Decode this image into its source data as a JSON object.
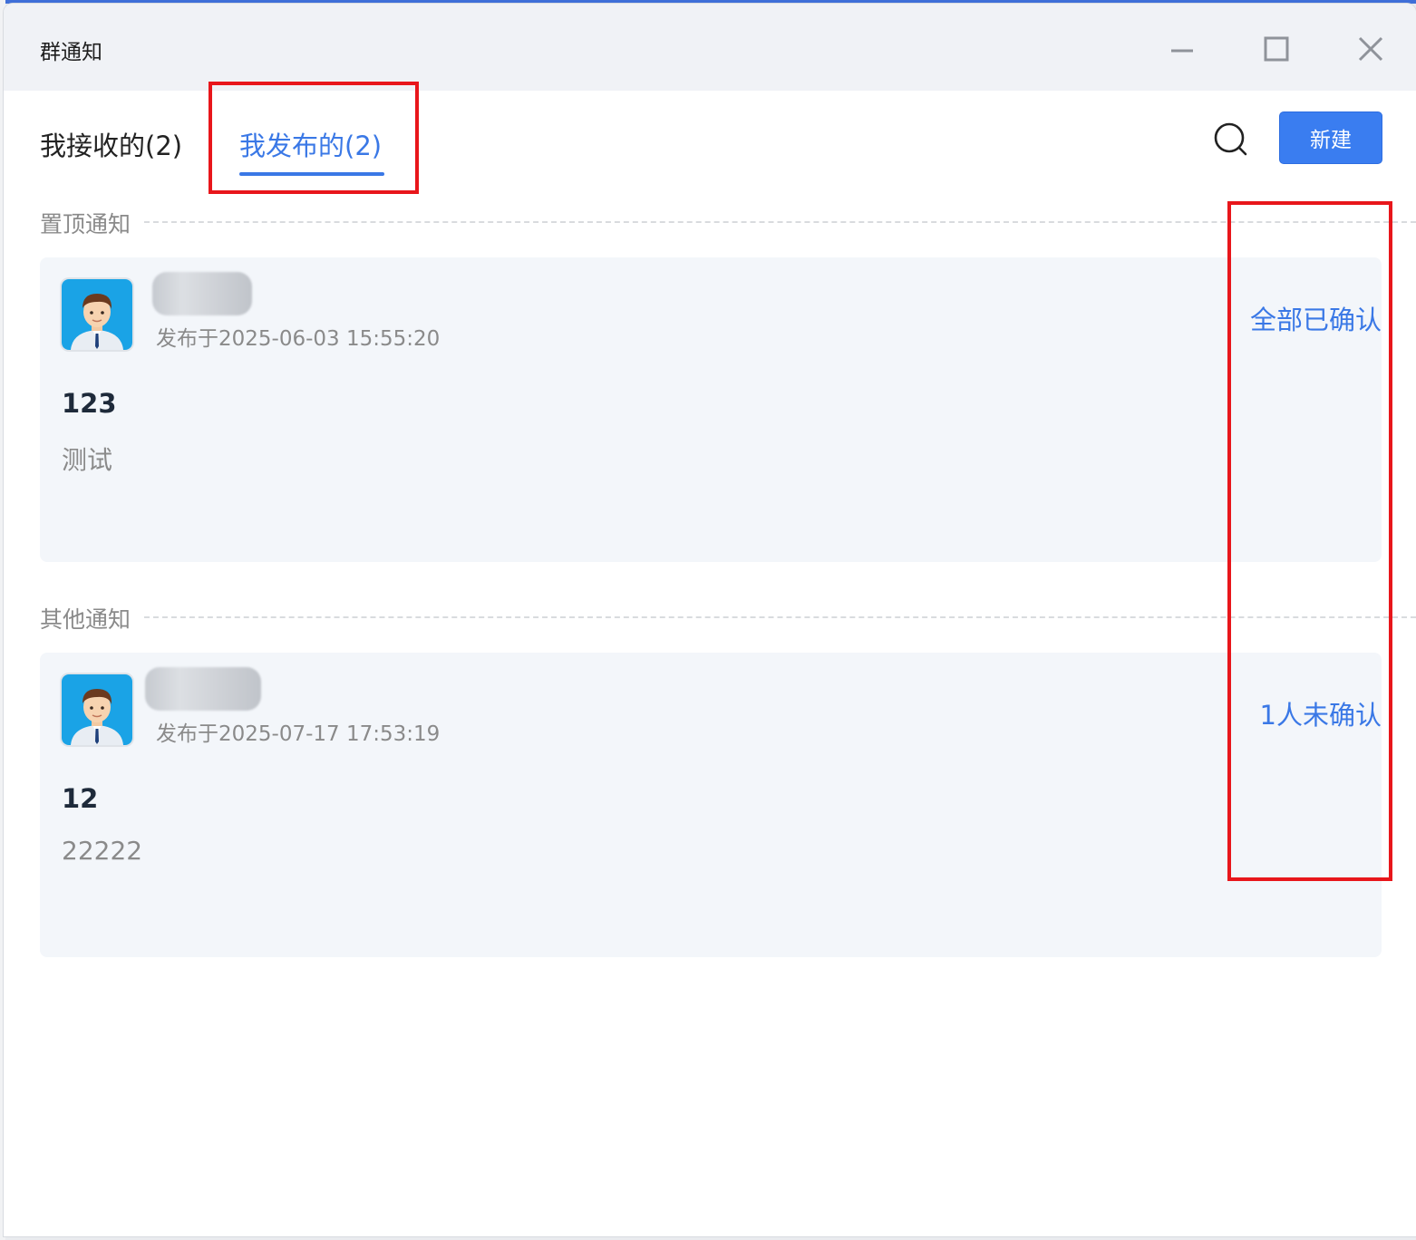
{
  "window": {
    "title": "群通知"
  },
  "tabs": [
    {
      "label": "我接收的(2)",
      "active": false
    },
    {
      "label": "我发布的(2)",
      "active": true
    }
  ],
  "toolbar": {
    "search_icon": "search-icon",
    "new_label": "新建"
  },
  "colors": {
    "accent": "#3a78e6",
    "annotation": "#e8161b",
    "card_bg": "#f3f6fa"
  },
  "sections": [
    {
      "label": "置顶通知",
      "notices": [
        {
          "published_at": "发布于2025-06-03 15:55:20",
          "title": "123",
          "body": "测试",
          "status": "全部已确认"
        }
      ]
    },
    {
      "label": "其他通知",
      "notices": [
        {
          "published_at": "发布于2025-07-17 17:53:19",
          "title": "12",
          "body": "22222",
          "status": "1人未确认"
        }
      ]
    }
  ]
}
